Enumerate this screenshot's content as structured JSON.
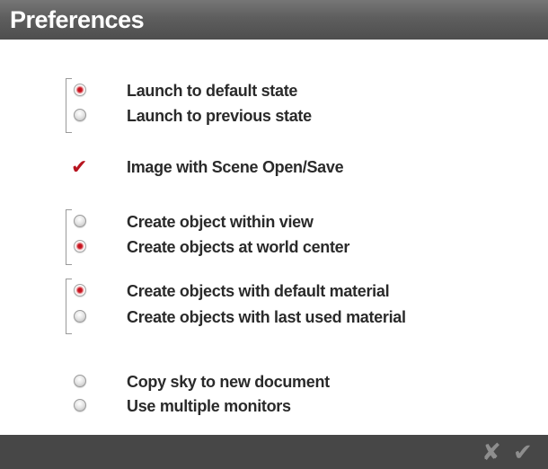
{
  "window": {
    "title": "Preferences"
  },
  "groups": [
    {
      "type": "radio",
      "options": [
        {
          "label": "Launch to default state",
          "selected": true
        },
        {
          "label": "Launch to previous state",
          "selected": false
        }
      ]
    },
    {
      "type": "checkbox",
      "options": [
        {
          "label": "Image with Scene Open/Save",
          "checked": true
        }
      ]
    },
    {
      "type": "radio",
      "options": [
        {
          "label": "Create object within view",
          "selected": false
        },
        {
          "label": "Create objects at world center",
          "selected": true
        }
      ]
    },
    {
      "type": "radio",
      "options": [
        {
          "label": "Create objects with default material",
          "selected": true
        },
        {
          "label": "Create objects with last used material",
          "selected": false
        }
      ]
    },
    {
      "type": "toggles",
      "options": [
        {
          "label": "Copy sky to new document",
          "selected": false
        },
        {
          "label": "Use multiple monitors",
          "selected": false
        }
      ]
    }
  ],
  "footer": {
    "cancel_icon": "✘",
    "ok_icon": "✔"
  },
  "icons": {
    "cancel": "x-icon",
    "ok": "checkmark-icon",
    "checked": "checkmark-icon"
  },
  "colors": {
    "titlebar": "#5e5e5e",
    "footer": "#474747",
    "accent_red": "#c81822",
    "text": "#2a2a2a"
  }
}
